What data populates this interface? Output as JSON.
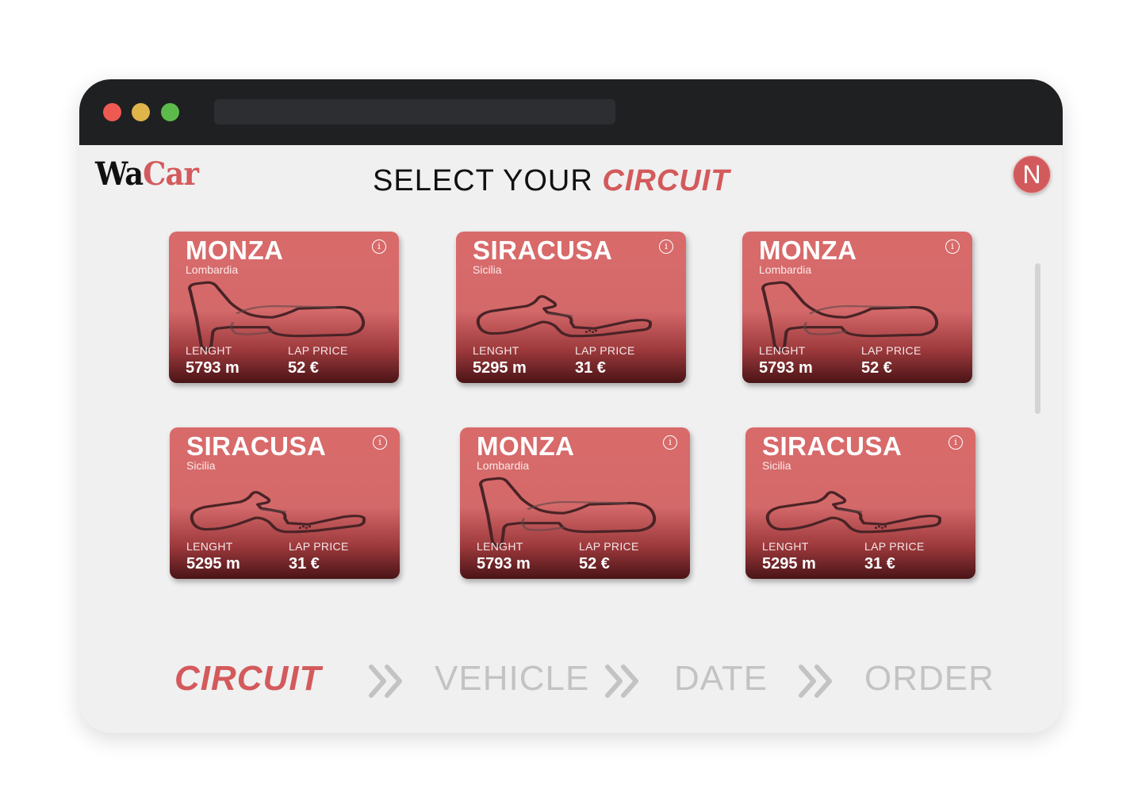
{
  "app": {
    "logo_part1": "Wa",
    "logo_part2": "Car"
  },
  "header": {
    "title_plain": "SELECT YOUR",
    "title_accent": "CIRCUIT"
  },
  "user": {
    "avatar_initial": "N"
  },
  "labels": {
    "length": "LENGHT",
    "price": "LAP PRICE",
    "info": "i"
  },
  "colors": {
    "accent": "#d35a5c",
    "titlebar": "#1f2022",
    "inactive": "#c3c3c3"
  },
  "cards": [
    {
      "name": "MONZA",
      "region": "Lombardia",
      "length": "5793 m",
      "price": "52 €",
      "track": "monza"
    },
    {
      "name": "SIRACUSA",
      "region": "Sicilia",
      "length": "5295 m",
      "price": "31 €",
      "track": "siracusa"
    },
    {
      "name": "MONZA",
      "region": "Lombardia",
      "length": "5793 m",
      "price": "52 €",
      "track": "monza"
    },
    {
      "name": "SIRACUSA",
      "region": "Sicilia",
      "length": "5295 m",
      "price": "31 €",
      "track": "siracusa"
    },
    {
      "name": "MONZA",
      "region": "Lombardia",
      "length": "5793 m",
      "price": "52 €",
      "track": "monza"
    },
    {
      "name": "SIRACUSA",
      "region": "Sicilia",
      "length": "5295 m",
      "price": "31 €",
      "track": "siracusa"
    }
  ],
  "steps": {
    "circuit": "CIRCUIT",
    "vehicle": "VEHICLE",
    "date": "DATE",
    "order": "ORDER",
    "current": "circuit"
  }
}
